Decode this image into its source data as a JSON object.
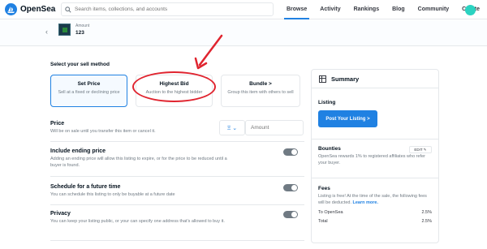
{
  "nav": {
    "logo": "OpenSea",
    "search_placeholder": "Search items, collections, and accounts",
    "items": [
      "Browse",
      "Activity",
      "Rankings",
      "Blog",
      "Community",
      "Create"
    ]
  },
  "asset": {
    "collection": "Amount",
    "name": "123"
  },
  "sell": {
    "title": "Select your sell method",
    "methods": [
      {
        "title": "Set Price",
        "desc": "Sell at a fixed or declining price"
      },
      {
        "title": "Highest Bid",
        "desc": "Auction to the highest bidder"
      },
      {
        "title": "Bundle >",
        "desc": "Group this item with others to sell"
      }
    ]
  },
  "price": {
    "title": "Price",
    "desc": "Will be on sale until you transfer this item or cancel it.",
    "selector": "Ξ ⌄",
    "placeholder": "Amount"
  },
  "ending": {
    "title": "Include ending price",
    "desc": "Adding an ending price will allow this listing to expire, or for the price to be reduced until a buyer is found."
  },
  "schedule": {
    "title": "Schedule for a future time",
    "desc": "You can schedule this listing to only be buyable at a future date"
  },
  "privacy": {
    "title": "Privacy",
    "desc": "You can keep your listing public, or your can specify one address that's allowed to buy it."
  },
  "summary": {
    "title": "Summary",
    "listing_label": "Listing",
    "post_button": "Post Your Listing >",
    "bounties_label": "Bounties",
    "edit": "EDIT ✎",
    "bounties_text": "OpenSea rewards 1% to registered affiliates who refer your buyer.",
    "fees_label": "Fees",
    "fees_text": "Listing is free! At the time of the sale, the following fees will be deducted.",
    "learn_more": "Learn more.",
    "fee_rows": [
      {
        "label": "To OpenSea",
        "value": "2.5%"
      },
      {
        "label": "Total",
        "value": "2.5%"
      }
    ]
  },
  "colors": {
    "accent": "#2081e2",
    "annotation": "#e0242f"
  }
}
